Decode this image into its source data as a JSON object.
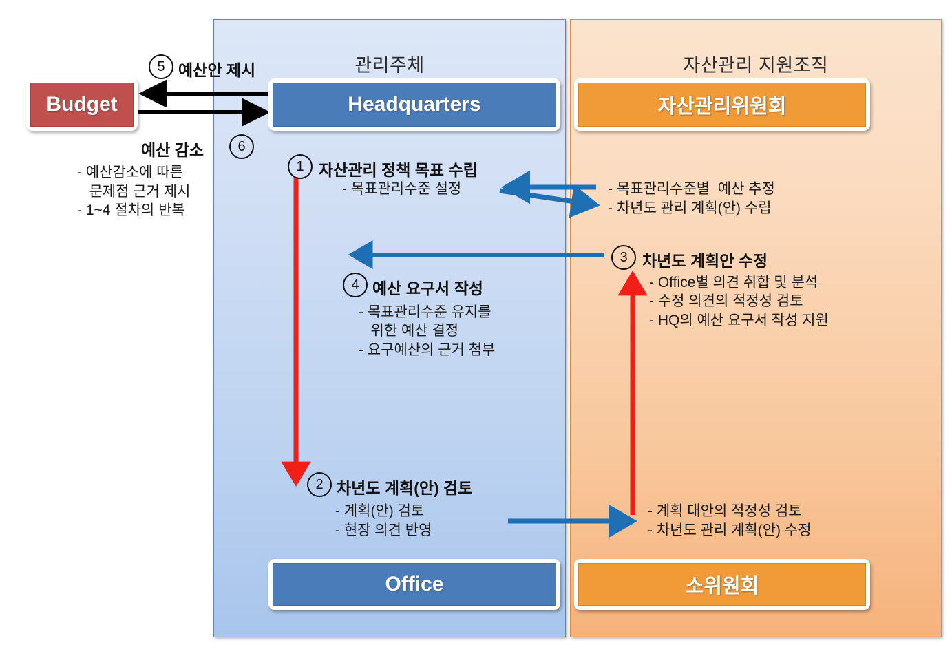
{
  "lanes": {
    "left_title": "관리주체",
    "right_title": "자산관리 지원조직"
  },
  "boxes": {
    "budget": "Budget",
    "headquarters": "Headquarters",
    "committee": "자산관리위원회",
    "office": "Office",
    "subcommittee": "소위원회"
  },
  "steps": {
    "s1": "1",
    "s2": "2",
    "s3": "3",
    "s4": "4",
    "s5": "5",
    "s6": "6"
  },
  "labels": {
    "step5_title": "예산안 제시",
    "step6_title": "예산 감소",
    "step6_body": "- 예산감소에 따른\n   문제점 근거 제시\n- 1~4 절차의 반복",
    "step1_title": "자산관리 정책 목표 수립",
    "step1_body": "- 목표관리수준 설정",
    "right1_body": "- 목표관리수준별  예산 추정\n- 차년도 관리 계획(안) 수립",
    "step3_title": "차년도 계획안 수정",
    "step3_body": "- Office별 의견 취합 및 분석\n- 수정 의견의 적정성 검토\n- HQ의 예산 요구서 작성 지원",
    "step4_title": "예산 요구서 작성",
    "step4_body": "- 목표관리수준 유지를\n   위한 예산 결정\n- 요구예산의 근거 첨부",
    "step2_title": "차년도 계획(안) 검토",
    "step2_body": "- 계획(안) 검토\n- 현장 의견 반영",
    "right2_body": "- 계획 대안의 적정성 검토\n- 차년도 관리 계획(안) 수정"
  },
  "colors": {
    "lane_left": "#bcd2f0",
    "lane_right": "#f8c79c",
    "box_blue": "#4a7cba",
    "box_orange": "#f19a38",
    "box_red": "#c0504d",
    "arrow_black": "#000000",
    "arrow_blue": "#1f6fb5",
    "arrow_red": "#f01f17"
  }
}
